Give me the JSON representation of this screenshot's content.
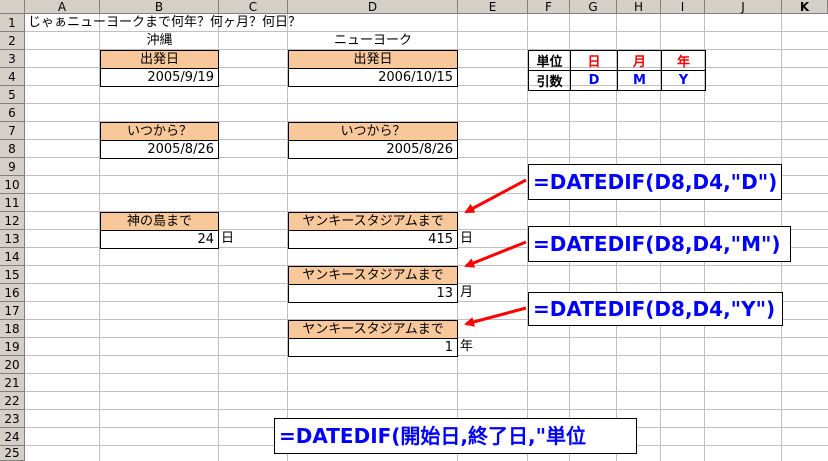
{
  "sheet": {
    "columns": [
      "A",
      "B",
      "C",
      "D",
      "E",
      "F",
      "G",
      "H",
      "I",
      "J",
      "K"
    ],
    "rows": [
      "1",
      "2",
      "3",
      "4",
      "5",
      "6",
      "7",
      "8",
      "9",
      "10",
      "11",
      "12",
      "13",
      "14",
      "15",
      "16",
      "17",
      "18",
      "19",
      "20",
      "21",
      "22",
      "23",
      "24",
      "25"
    ]
  },
  "title": "じゃぁニューヨークまで何年？何ヶ月？何日？",
  "okinawa": {
    "label": "沖縄",
    "departure_header": "出発日",
    "departure_value": "2005/9/19",
    "since_header": "いつから？",
    "since_value": "2005/8/26",
    "until_header": "神の島まで",
    "until_value": "24",
    "until_unit": "日"
  },
  "newyork": {
    "label": "ニューヨーク",
    "departure_header": "出発日",
    "departure_value": "2006/10/15",
    "since_header": "いつから？",
    "since_value": "2005/8/26",
    "results": [
      {
        "header": "ヤンキースタジアムまで",
        "value": "415",
        "unit": "日"
      },
      {
        "header": "ヤンキースタジアムまで",
        "value": "13",
        "unit": "月"
      },
      {
        "header": "ヤンキースタジアムまで",
        "value": "1",
        "unit": "年"
      }
    ]
  },
  "unit_table": {
    "row1_label": "単位",
    "row2_label": "引数",
    "units": [
      "日",
      "月",
      "年"
    ],
    "args": [
      "D",
      "M",
      "Y"
    ],
    "unit_color": "#ff0000",
    "arg_color": "#0000ff"
  },
  "formulas": {
    "day": "=DATEDIF(D8,D4,\"D\")",
    "month": "=DATEDIF(D8,D4,\"M\")",
    "year": "=DATEDIF(D8,D4,\"Y\")",
    "syntax": "=DATEDIF(開始日,終了日,\"単位"
  },
  "colors": {
    "header_fill": "#f9c89a",
    "arrow": "#ff0000",
    "formula_text": "#0000ff"
  }
}
